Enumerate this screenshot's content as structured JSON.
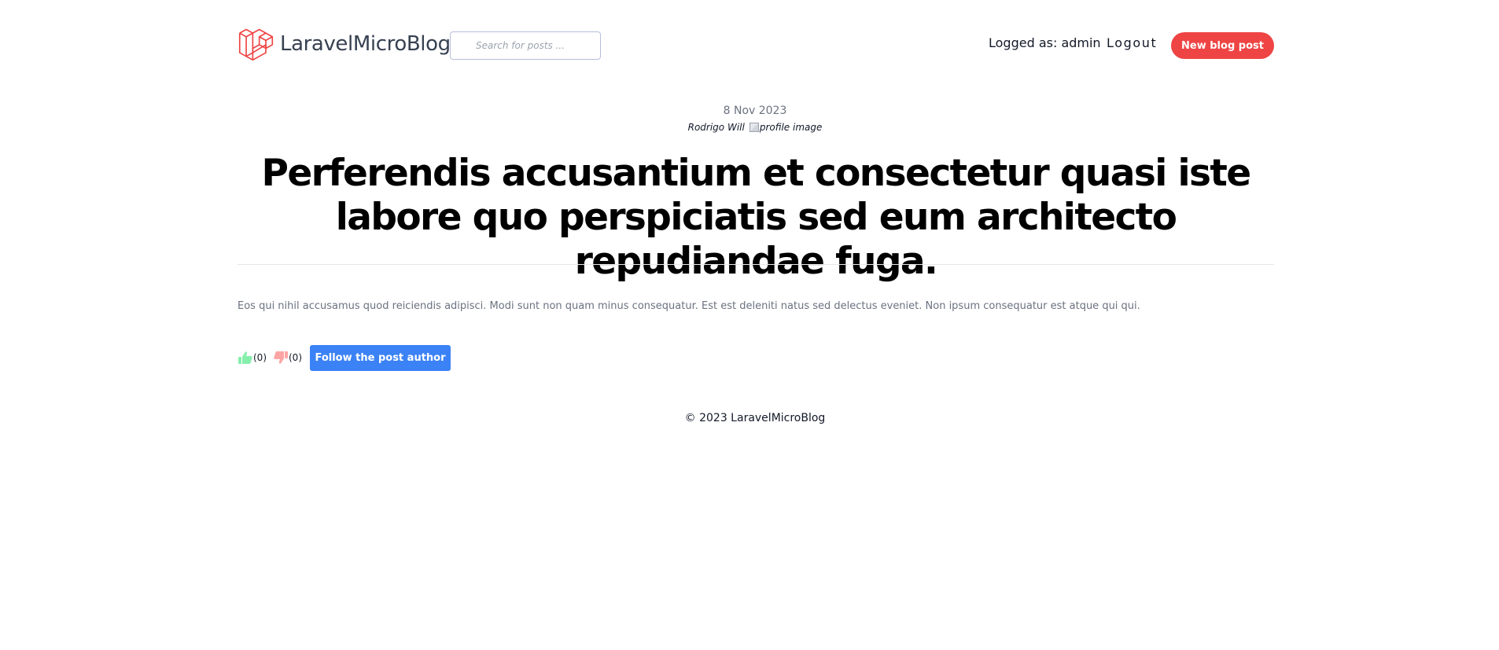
{
  "header": {
    "logo_text": "LaravelMicroBlog",
    "search_placeholder": "Search for posts ...",
    "logged_as": "Logged as: admin",
    "logout_label": "Logout",
    "new_post_label": "New blog post"
  },
  "post": {
    "date": "8 Nov 2023",
    "author": "Rodrigo Will",
    "author_image_alt": "profile image",
    "title": "Perferendis accusantium et consectetur quasi iste labore quo perspiciatis sed eum architecto repudiandae fuga.",
    "body": "Eos qui nihil accusamus quod reiciendis adipisci. Modi sunt non quam minus consequatur. Est est deleniti natus sed delectus eveniet. Non ipsum consequatur est atque qui qui.",
    "likes": "(0)",
    "dislikes": "(0)",
    "follow_label": "Follow the post author"
  },
  "footer": {
    "copyright": "© 2023 LaravelMicroBlog"
  },
  "icons": {
    "logo": "laravel-logo-icon",
    "like": "thumbs-up-icon",
    "dislike": "thumbs-down-icon"
  },
  "colors": {
    "brand_red": "#ef4444",
    "follow_blue": "#3b82f6",
    "like_green": "#86efac",
    "dislike_red": "#fca5a5"
  }
}
